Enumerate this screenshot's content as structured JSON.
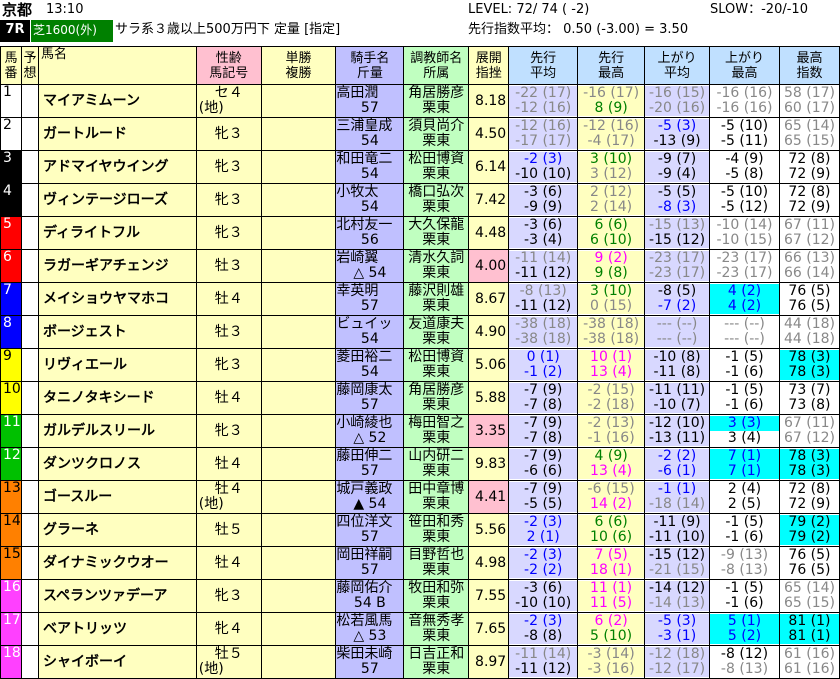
{
  "header": {
    "venue": "京都",
    "time": "13:10",
    "race_no": "7R",
    "course": "芝1600(外)",
    "race_info": "サラ系３歳以上500万円下 定量 [指定]",
    "level": "LEVEL:  72/ 74 ( -2)",
    "slow": "SLOW：-20/-10",
    "lead_avg": "先行指数平均：  0.50  (-3.00) =  3.50"
  },
  "columns": {
    "num": [
      "馬",
      "番"
    ],
    "pred": [
      "予",
      "想"
    ],
    "name": "馬名",
    "sex": [
      "性齢",
      "馬記号"
    ],
    "odds": [
      "単勝",
      "複勝"
    ],
    "jockey": [
      "騎手名",
      "斤量"
    ],
    "trainer": [
      "調教師名",
      "所属"
    ],
    "tenkai": [
      "展開",
      "指挫"
    ],
    "senko_avg": [
      "先行",
      "平均"
    ],
    "senko_max": [
      "先行",
      "最高"
    ],
    "agari_avg": [
      "上がり",
      "平均"
    ],
    "agari_max": [
      "上がり",
      "最高"
    ],
    "max_idx": [
      "最高",
      "指数"
    ]
  },
  "rows": [
    {
      "n": "1",
      "name": "マイアミムーン",
      "sex": "セ４",
      "sub": "(地)",
      "j1": "高田潤",
      "j2": "57",
      "t1": "角居勝彦",
      "t2": "栗東",
      "idx": "8.18",
      "sa": [
        "-22 (17)",
        "-12 (16)"
      ],
      "sm": [
        "-16 (17)",
        "8 (9)"
      ],
      "aa": [
        "-16 (15)",
        "-20 (16)"
      ],
      "am": [
        "-16 (16)",
        "-16 (16)"
      ],
      "mx": [
        "58 (17)",
        "60 (17)"
      ]
    },
    {
      "n": "2",
      "name": "ガートルード",
      "sex": "牝３",
      "sub": "",
      "j1": "三浦皇成",
      "j2": "54",
      "t1": "須貝尚介",
      "t2": "栗東",
      "idx": "4.50",
      "sa": [
        "-12 (16)",
        "-17 (17)"
      ],
      "sm": [
        "-12 (16)",
        "-4 (17)"
      ],
      "aa": [
        "-5 (3)",
        "-13 (9)"
      ],
      "am": [
        "-5 (10)",
        "-5 (11)"
      ],
      "mx": [
        "65 (14)",
        "65 (15)"
      ]
    },
    {
      "n": "3",
      "name": "アドマイヤウイング",
      "sex": "牝３",
      "sub": "",
      "j1": "和田竜二",
      "j2": "54",
      "t1": "松田博資",
      "t2": "栗東",
      "idx": "6.14",
      "sa": [
        "-2 (3)",
        "-10 (10)"
      ],
      "sm": [
        "3 (10)",
        "3 (12)"
      ],
      "aa": [
        "-9 (7)",
        "-9 (4)"
      ],
      "am": [
        "-4 (9)",
        "-5 (8)"
      ],
      "mx": [
        "72 (8)",
        "72 (9)"
      ]
    },
    {
      "n": "4",
      "name": "ヴィンテージローズ",
      "sex": "牝３",
      "sub": "",
      "j1": "小牧太",
      "j2": "54",
      "t1": "橋口弘次",
      "t2": "栗東",
      "idx": "7.42",
      "sa": [
        "-3 (6)",
        "-9 (9)"
      ],
      "sm": [
        "2 (12)",
        "2 (14)"
      ],
      "aa": [
        "-5 (5)",
        "-8 (3)"
      ],
      "am": [
        "-5 (10)",
        "-5 (12)"
      ],
      "mx": [
        "72 (8)",
        "72 (9)"
      ]
    },
    {
      "n": "5",
      "name": "ディライトフル",
      "sex": "牝３",
      "sub": "",
      "j1": "北村友一",
      "j2": "56",
      "t1": "大久保龍",
      "t2": "栗東",
      "idx": "4.48",
      "sa": [
        "-3 (6)",
        "-3 (4)"
      ],
      "sm": [
        "6 (6)",
        "6 (10)"
      ],
      "aa": [
        "-15 (13)",
        "-15 (12)"
      ],
      "am": [
        "-10 (14)",
        "-10 (15)"
      ],
      "mx": [
        "67 (11)",
        "67 (12)"
      ]
    },
    {
      "n": "6",
      "name": "ラガーギアチェンジ",
      "sex": "牡３",
      "sub": "",
      "j1": "岩崎翼",
      "j2": "△ 54",
      "t1": "清水久詞",
      "t2": "栗東",
      "idx": "4.00",
      "sa": [
        "-11 (14)",
        "-11 (12)"
      ],
      "sm": [
        "9 (2)",
        "9 (8)"
      ],
      "aa": [
        "-23 (17)",
        "-23 (17)"
      ],
      "am": [
        "-23 (17)",
        "-23 (17)"
      ],
      "mx": [
        "66 (13)",
        "66 (14)"
      ]
    },
    {
      "n": "7",
      "name": "メイショウヤマホコ",
      "sex": "牡４",
      "sub": "",
      "j1": "幸英明",
      "j2": "57",
      "t1": "藤沢則雄",
      "t2": "栗東",
      "idx": "8.67",
      "sa": [
        "-8 (13)",
        "-11 (12)"
      ],
      "sm": [
        "3 (10)",
        "0 (15)"
      ],
      "aa": [
        "-8 (5)",
        "-7 (2)"
      ],
      "am": [
        "4 (2)",
        "4 (2)"
      ],
      "mx": [
        "76 (5)",
        "76 (5)"
      ]
    },
    {
      "n": "8",
      "name": "ボージェスト",
      "sex": "牡３",
      "sub": "",
      "j1": "ビュイッ",
      "j2": "54",
      "t1": "友道康夫",
      "t2": "栗東",
      "idx": "4.90",
      "sa": [
        "-38 (18)",
        "-38 (18)"
      ],
      "sm": [
        "-38 (18)",
        "-38 (18)"
      ],
      "aa": [
        "--- (--)",
        "--- (--)"
      ],
      "am": [
        "--- (--)",
        "--- (--)"
      ],
      "mx": [
        "44 (18)",
        "44 (18)"
      ]
    },
    {
      "n": "9",
      "name": "リヴィエール",
      "sex": "牝３",
      "sub": "",
      "j1": "菱田裕二",
      "j2": "54",
      "t1": "松田博資",
      "t2": "栗東",
      "idx": "5.06",
      "sa": [
        "0 (1)",
        "-1 (2)"
      ],
      "sm": [
        "10 (1)",
        "13 (4)"
      ],
      "aa": [
        "-10 (8)",
        "-11 (8)"
      ],
      "am": [
        "-1 (5)",
        "-1 (6)"
      ],
      "mx": [
        "78 (3)",
        "78 (3)"
      ]
    },
    {
      "n": "10",
      "name": "タニノタキシード",
      "sex": "牡４",
      "sub": "",
      "j1": "藤岡康太",
      "j2": "57",
      "t1": "角居勝彦",
      "t2": "栗東",
      "idx": "5.88",
      "sa": [
        "-7 (9)",
        "-7 (8)"
      ],
      "sm": [
        "-2 (15)",
        "-2 (18)"
      ],
      "aa": [
        "-11 (11)",
        "-10 (7)"
      ],
      "am": [
        "-1 (5)",
        "-1 (6)"
      ],
      "mx": [
        "73 (7)",
        "73 (8)"
      ]
    },
    {
      "n": "11",
      "name": "ガルデルスリール",
      "sex": "牝３",
      "sub": "",
      "j1": "小崎綾也",
      "j2": "△ 52",
      "t1": "梅田智之",
      "t2": "栗東",
      "idx": "3.35",
      "sa": [
        "-7 (9)",
        "-7 (8)"
      ],
      "sm": [
        "-2 (13)",
        "-1 (16)"
      ],
      "aa": [
        "-12 (10)",
        "-13 (11)"
      ],
      "am": [
        "3 (3)",
        "3 (4)"
      ],
      "mx": [
        "67 (11)",
        "67 (12)"
      ]
    },
    {
      "n": "12",
      "name": "ダンツクロノス",
      "sex": "牡４",
      "sub": "",
      "j1": "藤田伸二",
      "j2": "57",
      "t1": "山内研二",
      "t2": "栗東",
      "idx": "9.83",
      "sa": [
        "-7 (9)",
        "-6 (6)"
      ],
      "sm": [
        "4 (9)",
        "13 (4)"
      ],
      "aa": [
        "-2 (2)",
        "-6 (1)"
      ],
      "am": [
        "7 (1)",
        "7 (1)"
      ],
      "mx": [
        "78 (3)",
        "78 (3)"
      ]
    },
    {
      "n": "13",
      "name": "ゴースルー",
      "sex": "牡４",
      "sub": "(地)",
      "j1": "城戸義政",
      "j2": "▲ 54",
      "t1": "田中章博",
      "t2": "栗東",
      "idx": "4.41",
      "sa": [
        "-7 (9)",
        "-5 (5)"
      ],
      "sm": [
        "-6 (15)",
        "14 (2)"
      ],
      "aa": [
        "-1 (1)",
        "-18 (14)"
      ],
      "am": [
        "2 (4)",
        "2 (5)"
      ],
      "mx": [
        "72 (8)",
        "72 (9)"
      ]
    },
    {
      "n": "14",
      "name": "グラーネ",
      "sex": "牡５",
      "sub": "",
      "j1": "四位洋文",
      "j2": "57",
      "t1": "笹田和秀",
      "t2": "栗東",
      "idx": "5.56",
      "sa": [
        "-2 (3)",
        "2 (1)"
      ],
      "sm": [
        "6 (6)",
        "10 (6)"
      ],
      "aa": [
        "-11 (9)",
        "-11 (10)"
      ],
      "am": [
        "-1 (5)",
        "-1 (6)"
      ],
      "mx": [
        "79 (2)",
        "79 (2)"
      ]
    },
    {
      "n": "15",
      "name": "ダイナミックウオー",
      "sex": "牡４",
      "sub": "",
      "j1": "岡田祥嗣",
      "j2": "57",
      "t1": "目野哲也",
      "t2": "栗東",
      "idx": "4.98",
      "sa": [
        "-2 (3)",
        "-2 (2)"
      ],
      "sm": [
        "7 (5)",
        "18 (1)"
      ],
      "aa": [
        "-15 (12)",
        "-21 (15)"
      ],
      "am": [
        "-9 (13)",
        "-8 (13)"
      ],
      "mx": [
        "76 (5)",
        "76 (5)"
      ]
    },
    {
      "n": "16",
      "name": "スペランツァデーア",
      "sex": "牝３",
      "sub": "",
      "j1": "藤岡佑介",
      "j2": "54 B",
      "t1": "牧田和弥",
      "t2": "栗東",
      "idx": "7.55",
      "sa": [
        "-3 (6)",
        "-10 (10)"
      ],
      "sm": [
        "11 (1)",
        "11 (5)"
      ],
      "aa": [
        "-14 (12)",
        "-14 (13)"
      ],
      "am": [
        "-1 (5)",
        "-1 (6)"
      ],
      "mx": [
        "65 (14)",
        "65 (15)"
      ]
    },
    {
      "n": "17",
      "name": "ベアトリッツ",
      "sex": "牝４",
      "sub": "",
      "j1": "松若風馬",
      "j2": "△ 53",
      "t1": "音無秀孝",
      "t2": "栗東",
      "idx": "7.65",
      "sa": [
        "-2 (3)",
        "-8 (8)"
      ],
      "sm": [
        "6 (2)",
        "5 (10)"
      ],
      "aa": [
        "-5 (3)",
        "-3 (1)"
      ],
      "am": [
        "5 (1)",
        "5 (2)"
      ],
      "mx": [
        "81 (1)",
        "81 (1)"
      ]
    },
    {
      "n": "18",
      "name": "シャイボーイ",
      "sex": "牡５",
      "sub": "(地)",
      "j1": "柴田未崎",
      "j2": "57",
      "t1": "日吉正和",
      "t2": "栗東",
      "idx": "8.97",
      "sa": [
        "-11 (14)",
        "-11 (12)"
      ],
      "sm": [
        "-3 (14)",
        "-3 (16)"
      ],
      "aa": [
        "-12 (18)",
        "-12 (17)"
      ],
      "am": [
        "-8 (12)",
        "-8 (13)"
      ],
      "mx": [
        "61 (16)",
        "61 (16)"
      ]
    }
  ]
}
